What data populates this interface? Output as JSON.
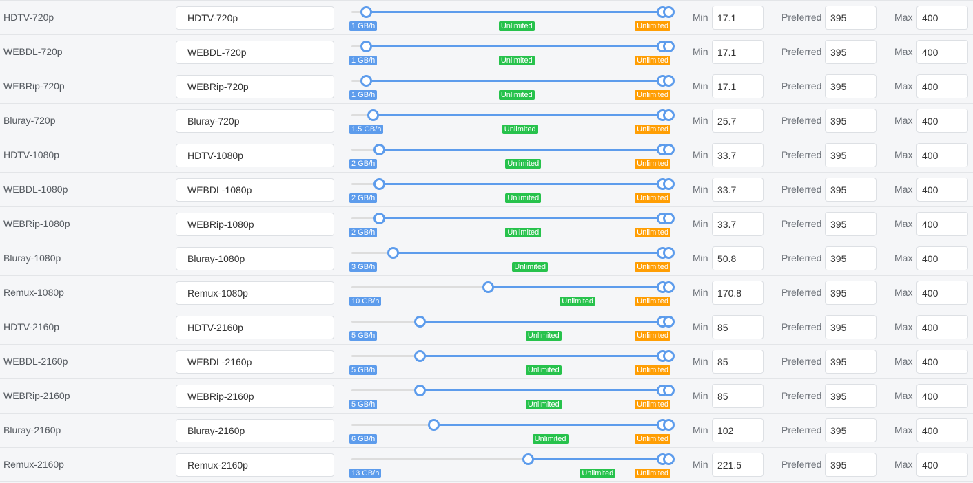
{
  "colors": {
    "accent": "#5d9cec",
    "preferred_badge": "#27c24c",
    "max_badge": "#ff9e04",
    "track": "#dddddd"
  },
  "field_labels": {
    "min": "Min",
    "preferred": "Preferred",
    "max": "Max"
  },
  "slider_scale": {
    "min_value": 0,
    "max_value": 400
  },
  "rows": [
    {
      "label": "HDTV-720p",
      "title": "HDTV-720p",
      "min_badge": "1 GB/h",
      "preferred_badge": "Unlimited",
      "max_badge": "Unlimited",
      "min": "17.1",
      "preferred": "395",
      "max": "400"
    },
    {
      "label": "WEBDL-720p",
      "title": "WEBDL-720p",
      "min_badge": "1 GB/h",
      "preferred_badge": "Unlimited",
      "max_badge": "Unlimited",
      "min": "17.1",
      "preferred": "395",
      "max": "400"
    },
    {
      "label": "WEBRip-720p",
      "title": "WEBRip-720p",
      "min_badge": "1 GB/h",
      "preferred_badge": "Unlimited",
      "max_badge": "Unlimited",
      "min": "17.1",
      "preferred": "395",
      "max": "400"
    },
    {
      "label": "Bluray-720p",
      "title": "Bluray-720p",
      "min_badge": "1.5 GB/h",
      "preferred_badge": "Unlimited",
      "max_badge": "Unlimited",
      "min": "25.7",
      "preferred": "395",
      "max": "400"
    },
    {
      "label": "HDTV-1080p",
      "title": "HDTV-1080p",
      "min_badge": "2 GB/h",
      "preferred_badge": "Unlimited",
      "max_badge": "Unlimited",
      "min": "33.7",
      "preferred": "395",
      "max": "400"
    },
    {
      "label": "WEBDL-1080p",
      "title": "WEBDL-1080p",
      "min_badge": "2 GB/h",
      "preferred_badge": "Unlimited",
      "max_badge": "Unlimited",
      "min": "33.7",
      "preferred": "395",
      "max": "400"
    },
    {
      "label": "WEBRip-1080p",
      "title": "WEBRip-1080p",
      "min_badge": "2 GB/h",
      "preferred_badge": "Unlimited",
      "max_badge": "Unlimited",
      "min": "33.7",
      "preferred": "395",
      "max": "400"
    },
    {
      "label": "Bluray-1080p",
      "title": "Bluray-1080p",
      "min_badge": "3 GB/h",
      "preferred_badge": "Unlimited",
      "max_badge": "Unlimited",
      "min": "50.8",
      "preferred": "395",
      "max": "400"
    },
    {
      "label": "Remux-1080p",
      "title": "Remux-1080p",
      "min_badge": "10 GB/h",
      "preferred_badge": "Unlimited",
      "max_badge": "Unlimited",
      "min": "170.8",
      "preferred": "395",
      "max": "400"
    },
    {
      "label": "HDTV-2160p",
      "title": "HDTV-2160p",
      "min_badge": "5 GB/h",
      "preferred_badge": "Unlimited",
      "max_badge": "Unlimited",
      "min": "85",
      "preferred": "395",
      "max": "400"
    },
    {
      "label": "WEBDL-2160p",
      "title": "WEBDL-2160p",
      "min_badge": "5 GB/h",
      "preferred_badge": "Unlimited",
      "max_badge": "Unlimited",
      "min": "85",
      "preferred": "395",
      "max": "400"
    },
    {
      "label": "WEBRip-2160p",
      "title": "WEBRip-2160p",
      "min_badge": "5 GB/h",
      "preferred_badge": "Unlimited",
      "max_badge": "Unlimited",
      "min": "85",
      "preferred": "395",
      "max": "400"
    },
    {
      "label": "Bluray-2160p",
      "title": "Bluray-2160p",
      "min_badge": "6 GB/h",
      "preferred_badge": "Unlimited",
      "max_badge": "Unlimited",
      "min": "102",
      "preferred": "395",
      "max": "400"
    },
    {
      "label": "Remux-2160p",
      "title": "Remux-2160p",
      "min_badge": "13 GB/h",
      "preferred_badge": "Unlimited",
      "max_badge": "Unlimited",
      "min": "221.5",
      "preferred": "395",
      "max": "400"
    }
  ]
}
